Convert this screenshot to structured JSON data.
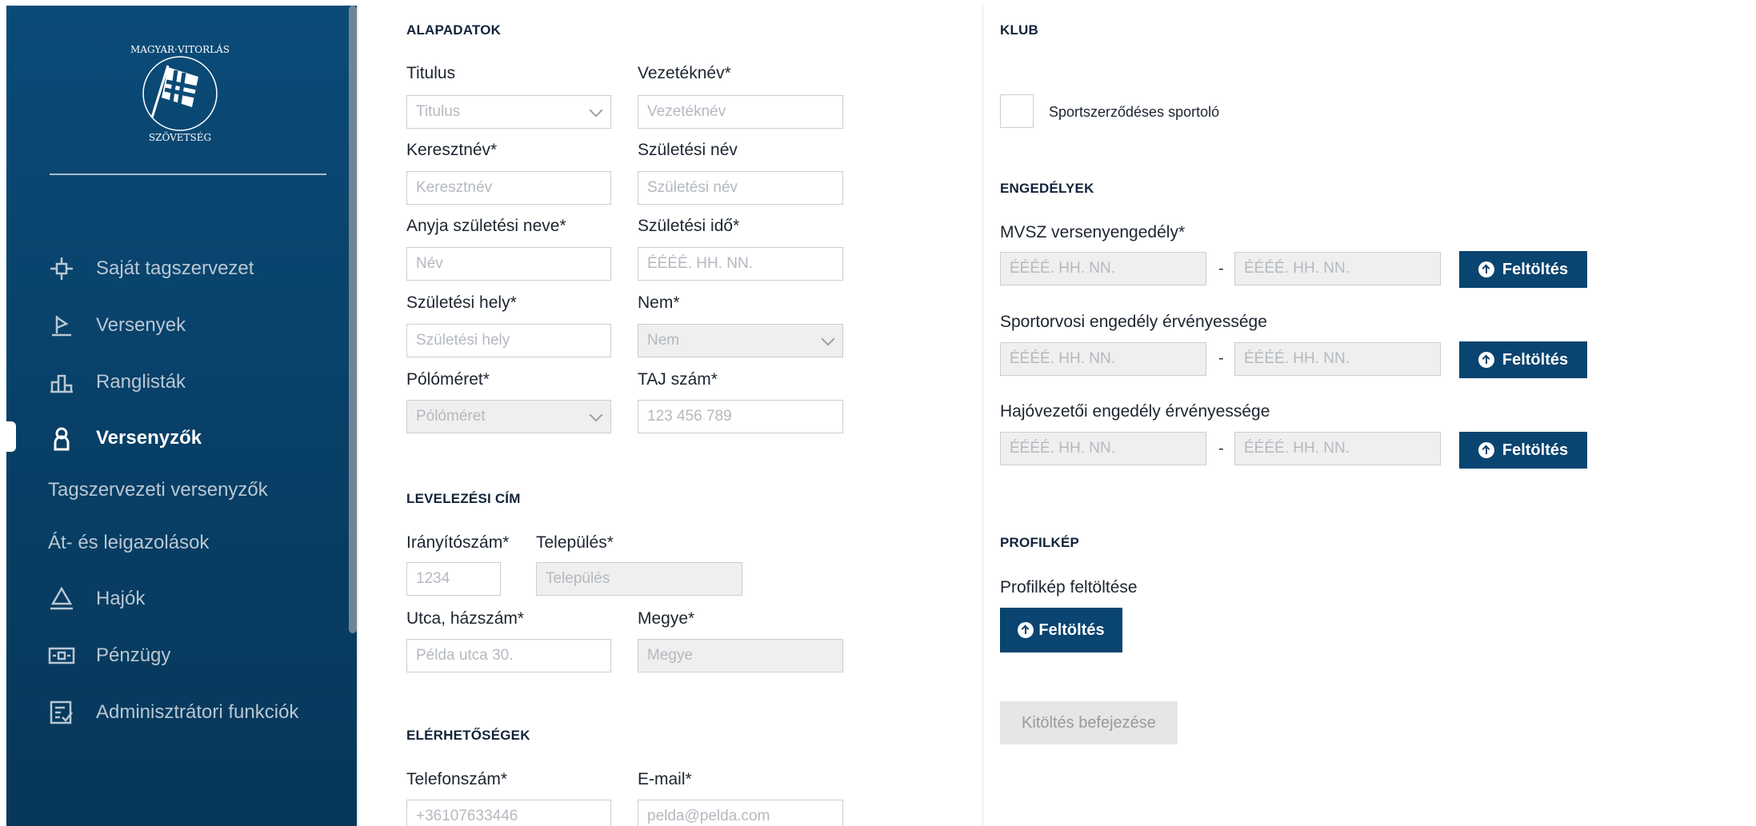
{
  "sidebar": {
    "logo_alt": "MAGYAR VITORLÁS SZÖVETSÉG · HUNGARIAN SAILING FEDERATION",
    "items": [
      {
        "label": "Saját tagszervezet",
        "icon": "crosshair-icon"
      },
      {
        "label": "Versenyek",
        "icon": "flag-icon"
      },
      {
        "label": "Ranglisták",
        "icon": "podium-icon"
      },
      {
        "label": "Versenyzők",
        "icon": "person-icon"
      },
      {
        "label": "Tagszervezeti versenyzők"
      },
      {
        "label": "Át- és leigazolások"
      },
      {
        "label": "Hajók",
        "icon": "sailboat-icon"
      },
      {
        "label": "Pénzügy",
        "icon": "money-icon"
      },
      {
        "label": "Adminisztrátori funkciók",
        "icon": "checklist-icon"
      }
    ],
    "active": "Versenyzők"
  },
  "basic": {
    "title": "ALAPADATOK",
    "titulus": {
      "label": "Titulus",
      "placeholder": "Titulus"
    },
    "vezeteknev": {
      "label": "Vezetéknév*",
      "placeholder": "Vezetéknév"
    },
    "keresztnev": {
      "label": "Keresztnév*",
      "placeholder": "Keresztnév"
    },
    "szuletesi_nev": {
      "label": "Születési név",
      "placeholder": "Születési név"
    },
    "anyja_neve": {
      "label": "Anyja születési neve*",
      "placeholder": "Név"
    },
    "szuletesi_ido": {
      "label": "Születési idő*",
      "placeholder": "ÉÉÉÉ. HH. NN."
    },
    "szuletesi_hely": {
      "label": "Születési hely*",
      "placeholder": "Születési hely"
    },
    "nem": {
      "label": "Nem*",
      "placeholder": "Nem"
    },
    "polomeret": {
      "label": "Pólóméret*",
      "placeholder": "Pólóméret"
    },
    "taj": {
      "label": "TAJ szám*",
      "placeholder": "123 456 789"
    }
  },
  "address": {
    "title": "LEVELEZÉSI CÍM",
    "iranyitoszam": {
      "label": "Irányítószám*",
      "placeholder": "1234"
    },
    "telepules": {
      "label": "Település*",
      "placeholder": "Település"
    },
    "utca": {
      "label": "Utca, házszám*",
      "placeholder": "Példa utca 30."
    },
    "megye": {
      "label": "Megye*",
      "placeholder": "Megye"
    }
  },
  "contact": {
    "title": "ELÉRHETŐSÉGEK",
    "telefon": {
      "label": "Telefonszám*",
      "placeholder": "+36107633446"
    },
    "email": {
      "label": "E-mail*",
      "placeholder": "pelda@pelda.com"
    }
  },
  "club": {
    "title": "KLUB",
    "checkbox_label": "Sportszerződéses sportoló"
  },
  "permits": {
    "title": "ENGEDÉLYEK",
    "rows": [
      {
        "label": "MVSZ versenyengedély*",
        "from": "ÉÉÉÉ. HH. NN.",
        "to": "ÉÉÉÉ. HH. NN.",
        "button": "Feltöltés"
      },
      {
        "label": "Sportorvosi engedély érvényessége",
        "from": "ÉÉÉÉ. HH. NN.",
        "to": "ÉÉÉÉ. HH. NN.",
        "button": "Feltöltés"
      },
      {
        "label": "Hajóvezetői engedély érvényessége",
        "from": "ÉÉÉÉ. HH. NN.",
        "to": "ÉÉÉÉ. HH. NN.",
        "button": "Feltöltés"
      }
    ],
    "dash": "-"
  },
  "profile": {
    "title": "PROFILKÉP",
    "label": "Profilkép feltöltése",
    "button": "Feltöltés"
  },
  "submit": {
    "label": "Kitöltés befejezése"
  }
}
